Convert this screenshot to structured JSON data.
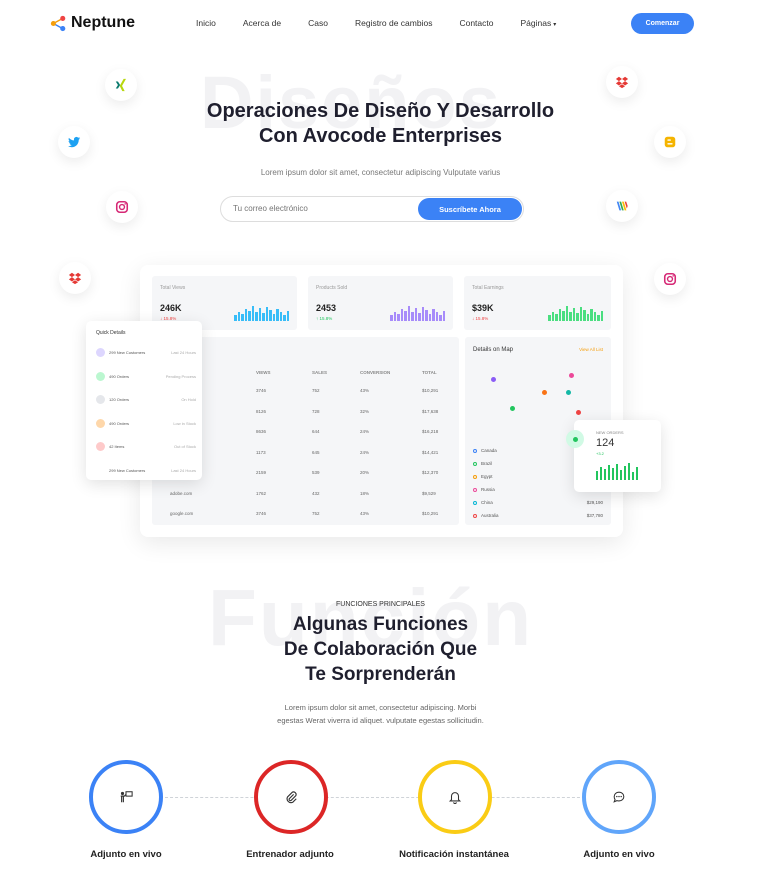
{
  "header": {
    "logo_text": "Neptune",
    "nav": [
      "Inicio",
      "Acerca de",
      "Caso",
      "Registro de cambios",
      "Contacto",
      "Páginas"
    ],
    "start_button": "Comenzar"
  },
  "hero": {
    "bg_word": "Diseños",
    "title_line1": "Operaciones De Diseño Y Desarrollo",
    "title_line2": "Con Avocode Enterprises",
    "subtitle": "Lorem ipsum dolor sit amet, consectetur adipiscing Vulputate varius",
    "email_placeholder": "Tu correo electrónico",
    "subscribe_button": "Suscríbete Ahora"
  },
  "dashboard": {
    "stats": [
      {
        "label": "Total Views",
        "value": "246K",
        "change": "↓ 15.8%"
      },
      {
        "label": "Products Sold",
        "value": "2453",
        "change": "↑ 15.8%"
      },
      {
        "label": "Total Earnings",
        "value": "$39K",
        "change": "↓ 15.8%"
      }
    ],
    "table": {
      "headers": [
        "VIEWS",
        "SALES",
        "CONVERSION",
        "TOTAL"
      ],
      "rows": [
        {
          "name": "",
          "views": "3746",
          "sales": "752",
          "conv": "43%",
          "total": "$10,291"
        },
        {
          "name": "",
          "views": "8126",
          "sales": "728",
          "conv": "32%",
          "total": "$17,638"
        },
        {
          "name": "",
          "views": "8636",
          "sales": "644",
          "conv": "24%",
          "total": "$16,218"
        },
        {
          "name": "",
          "views": "1173",
          "sales": "645",
          "conv": "24%",
          "total": "$14,421"
        },
        {
          "name": "",
          "views": "2159",
          "sales": "539",
          "conv": "20%",
          "total": "$12,370"
        },
        {
          "name": "adobe.com",
          "views": "1762",
          "sales": "432",
          "conv": "18%",
          "total": "$9,529"
        },
        {
          "name": "google.com",
          "views": "3746",
          "sales": "752",
          "conv": "43%",
          "total": "$10,291"
        }
      ]
    },
    "map": {
      "title": "Details on Map",
      "more": "View All List",
      "countries": [
        {
          "name": "Canada",
          "value": ""
        },
        {
          "name": "Brazil",
          "value": ""
        },
        {
          "name": "Egypt",
          "value": ""
        },
        {
          "name": "Russia",
          "value": ""
        },
        {
          "name": "China",
          "value": "$29,190"
        },
        {
          "name": "Australia",
          "value": "$37,780"
        }
      ]
    },
    "quick": {
      "title": "Quick Details",
      "rows": [
        {
          "text": "299 New Customers",
          "right": "Last 24 Hours"
        },
        {
          "text": "490 Orders",
          "right": "Pending Process"
        },
        {
          "text": "120 Orders",
          "right": "On Hold"
        },
        {
          "text": "490 Orders",
          "right": "Low in Stock"
        },
        {
          "text": "42 Items",
          "right": "Out of Stock"
        },
        {
          "text": "299 New Customers",
          "right": "Last 24 Hours"
        }
      ]
    },
    "orders": {
      "label": "NEW ORDERS",
      "value": "124",
      "change": "+3.2"
    }
  },
  "features": {
    "bg_word": "Función",
    "eyebrow": "FUNCIONES PRINCIPALES",
    "title_line1": "Algunas Funciones",
    "title_line2": "De Colaboración Que",
    "title_line3": "Te Sorprenderán",
    "desc_line1": "Lorem ipsum dolor sit amet, consectetur adipiscing. Morbi",
    "desc_line2": "egestas Werat viverra id aliquet. vulputate egestas sollicitudin.",
    "items": [
      {
        "label": "Adjunto en vivo",
        "icon": "presenter-icon",
        "color": "#3b82f6"
      },
      {
        "label": "Entrenador adjunto",
        "icon": "paperclip-icon",
        "color": "#dc2626"
      },
      {
        "label": "Notificación instantánea",
        "icon": "bell-icon",
        "color": "#facc15"
      },
      {
        "label": "Adjunto en vivo",
        "icon": "chat-icon",
        "color": "#60a5fa"
      }
    ]
  },
  "colors": {
    "accent": "#3b82f6"
  },
  "social_icons": [
    "xing-icon",
    "dropbox-icon",
    "twitter-icon",
    "blogger-icon",
    "instagram-icon",
    "google-wallet-icon",
    "dropbox-icon",
    "instagram-icon"
  ]
}
